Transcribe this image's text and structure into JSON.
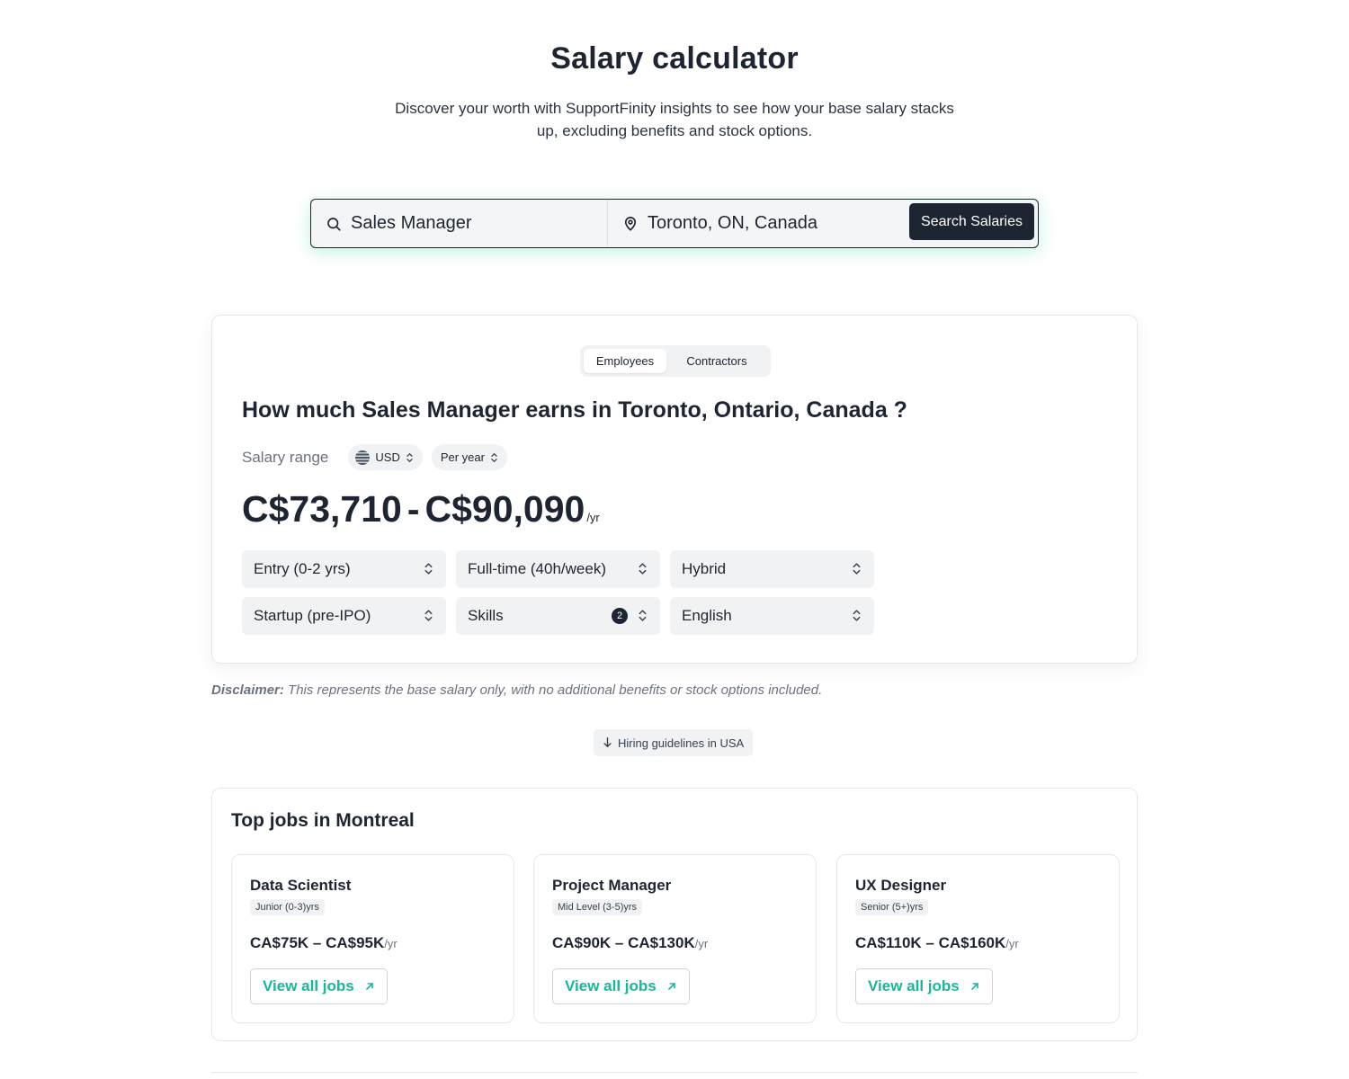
{
  "hero": {
    "title": "Salary calculator",
    "subtitle": "Discover your worth with SupportFinity insights to see how your base salary stacks up, excluding benefits and stock options."
  },
  "search": {
    "job_value": "Sales Manager",
    "location_value": "Toronto, ON, Canada",
    "button_label": "Search Salaries",
    "icons": {
      "job": "search-icon",
      "location": "map-pin-icon"
    }
  },
  "result": {
    "tabs": [
      {
        "label": "Employees",
        "active": true
      },
      {
        "label": "Contractors",
        "active": false
      }
    ],
    "heading": "How much Sales Manager earns in Toronto, Ontario, Canada ?",
    "range_label": "Salary range",
    "currency": "USD",
    "period": "Per year",
    "min": "C$73,710",
    "separator": "-",
    "max": "C$90,090",
    "per": "/yr",
    "filters": [
      {
        "label": "Entry (0-2 yrs)"
      },
      {
        "label": "Full-time (40h/week)"
      },
      {
        "label": "Hybrid"
      },
      {
        "label": "Startup (pre-IPO)"
      },
      {
        "label": "Skills",
        "badge": "2"
      },
      {
        "label": "English"
      }
    ]
  },
  "disclaimer": {
    "label": "Disclaimer:",
    "text": " This represents the base salary only, with no additional benefits or stock options included."
  },
  "hiring": {
    "label": "Hiring guidelines in USA"
  },
  "top_jobs": {
    "title": "Top jobs in Montreal",
    "jobs": [
      {
        "title": "Data Scientist",
        "level": "Junior (0-3)yrs",
        "salary": "CA$75K – CA$95K",
        "per": "/yr",
        "link": "View all jobs"
      },
      {
        "title": "Project Manager",
        "level": "Mid Level (3-5)yrs",
        "salary": "CA$90K – CA$130K",
        "per": "/yr",
        "link": "View all jobs"
      },
      {
        "title": "UX Designer",
        "level": "Senior (5+)yrs",
        "salary": "CA$110K – CA$160K",
        "per": "/yr",
        "link": "View all jobs"
      }
    ]
  },
  "colors": {
    "dark": "#1e2532",
    "accent": "#19b79a",
    "glow": "#50dcaa"
  }
}
